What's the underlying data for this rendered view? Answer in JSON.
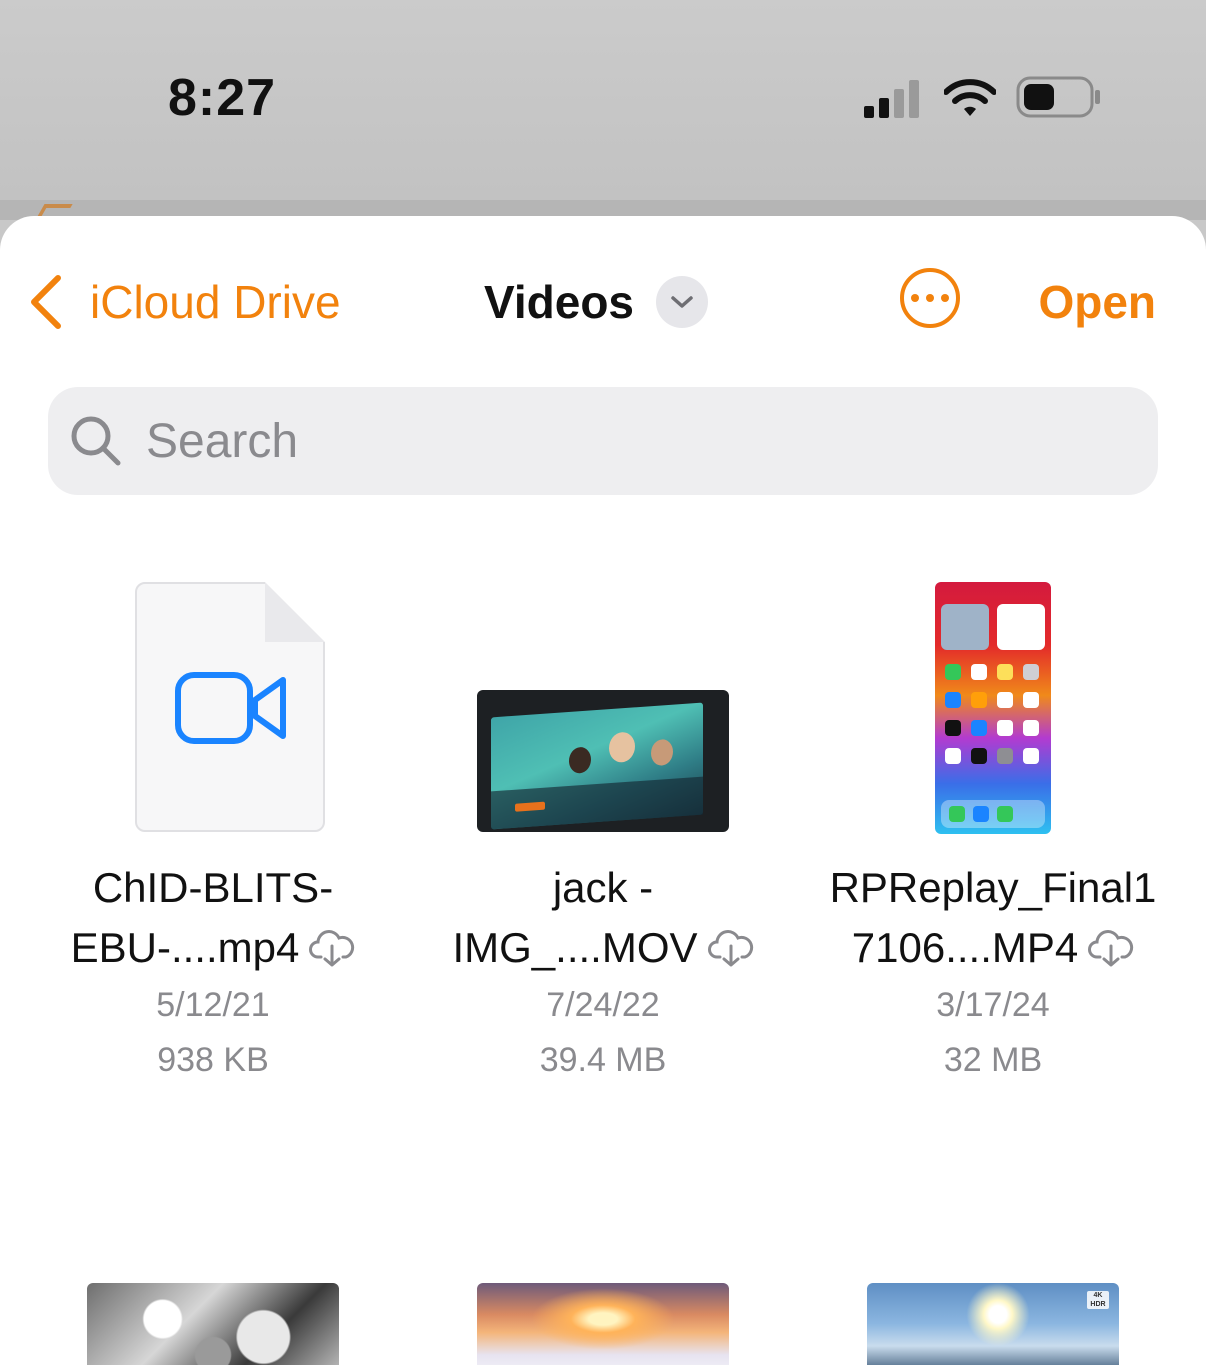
{
  "status_bar": {
    "time": "8:27",
    "icons": [
      "cellular-signal-icon",
      "wifi-icon",
      "battery-icon"
    ]
  },
  "nav": {
    "back_label": "iCloud Drive",
    "title": "Videos",
    "open_label": "Open"
  },
  "search": {
    "placeholder": "Search",
    "value": ""
  },
  "files": [
    {
      "name_line1": "ChID-BLITS-",
      "name_line2": "EBU-....mp4",
      "date": "5/12/21",
      "size": "938 KB",
      "thumbnail": "generic-video-document"
    },
    {
      "name_line1": "jack -",
      "name_line2": "IMG_....MOV",
      "date": "7/24/22",
      "size": "39.4 MB",
      "thumbnail": "tv-screen-photo"
    },
    {
      "name_line1": "RPReplay_Final1",
      "name_line2": "7106....MP4",
      "date": "3/17/24",
      "size": "32 MB",
      "thumbnail": "iphone-home-screen"
    }
  ],
  "bottom_row_thumbnails": [
    "ice-crystals",
    "sunset-over-clouds",
    "mount-fuji-sunrise"
  ],
  "colors": {
    "accent": "#f2820d",
    "video_icon": "#1a84ff",
    "secondary_text": "#8a8a8e"
  }
}
